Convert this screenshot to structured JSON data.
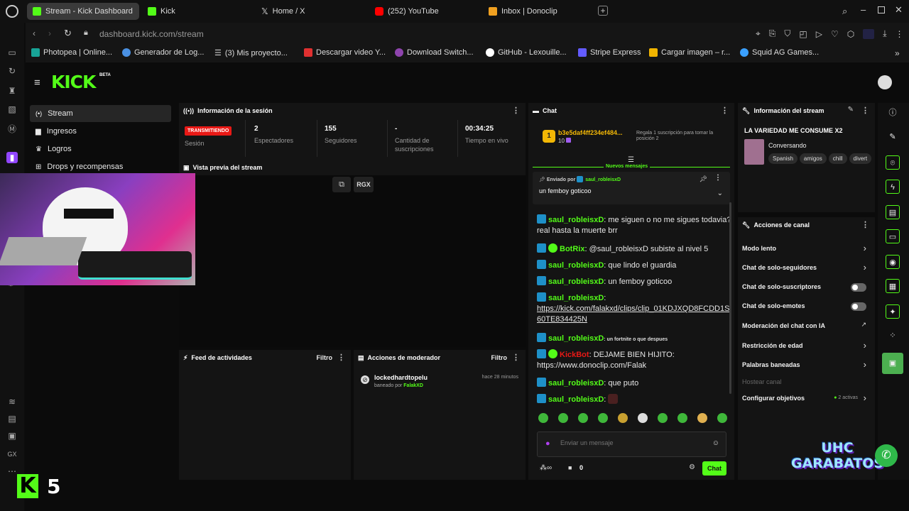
{
  "browser": {
    "tabs": [
      {
        "label": "Stream - Kick Dashboard",
        "active": true,
        "color": "#53fc18"
      },
      {
        "label": "Kick",
        "active": false,
        "color": "#53fc18"
      },
      {
        "label": "Home / X",
        "active": false,
        "color": "#cccccc"
      },
      {
        "label": "(252) YouTube",
        "active": false,
        "color": "#ff0000"
      },
      {
        "label": "Inbox | Donoclip",
        "active": false,
        "color": "#f0a020"
      }
    ],
    "url_host": "dashboard.kick.com",
    "url_path": "/stream",
    "bookmarks": [
      {
        "label": "Photopea | Online...",
        "color": "#18a497"
      },
      {
        "label": "Generador de Log...",
        "color": "#4a90e2"
      },
      {
        "label": "(3) Mis proyecto...",
        "color": "#cccccc"
      },
      {
        "label": "Descargar video Y...",
        "color": "#e03030"
      },
      {
        "label": "Download Switch...",
        "color": "#8e44ad"
      },
      {
        "label": "GitHub - Lexouille...",
        "color": "#ffffff"
      },
      {
        "label": "Stripe Express",
        "color": "#635bff"
      },
      {
        "label": "Cargar imagen – r...",
        "color": "#f0b400"
      },
      {
        "label": "Squid AG Games...",
        "color": "#3aa0ff"
      }
    ]
  },
  "app": {
    "logo": "KICK",
    "logo_badge": "BETA",
    "nav": [
      {
        "label": "Stream",
        "icon": "broadcast-icon",
        "active": true
      },
      {
        "label": "Ingresos",
        "icon": "wallet-icon",
        "active": false
      },
      {
        "label": "Logros",
        "icon": "trophy-icon",
        "active": false
      },
      {
        "label": "Drops y recompensas",
        "icon": "gift-icon",
        "active": false
      }
    ],
    "session": {
      "title": "Información de la sesión",
      "status_badge": "TRANSMITIENDO",
      "status_label": "Sesión",
      "stats": [
        {
          "value": "2",
          "label": "Espectadores"
        },
        {
          "value": "155",
          "label": "Seguidores"
        },
        {
          "value": "-",
          "label": "Cantidad de suscripciones"
        },
        {
          "value": "00:34:25",
          "label": "Tiempo en vivo"
        }
      ]
    },
    "preview": {
      "title": "Vista previa del stream",
      "popout_label": "RGX"
    },
    "activity": {
      "title": "Feed de actividades",
      "filter": "Filtro"
    },
    "modactions": {
      "title": "Acciones de moderador",
      "filter": "Filtro",
      "entries": [
        {
          "user": "lockedhardtopelu",
          "detail_prefix": "baneado por",
          "by": "FalakXD",
          "time": "hace 28 minutos"
        }
      ]
    },
    "chat": {
      "title": "Chat",
      "gifter": {
        "name": "b3e5daf4ff234ef484...",
        "count": "10",
        "promo": "Regala 1 suscripción para tomar la posición 2"
      },
      "new_messages": "Nuevos mensajes",
      "pinned": {
        "sent_by_label": "Enviado por",
        "user": "saul_robleisxD",
        "text": "un femboy goticoo"
      },
      "messages": [
        {
          "user": "saul_robleisxD",
          "text": "me siguen o no me sigues todavia? real hasta la muerte brr"
        },
        {
          "user": "BotRix",
          "text": "@saul_robleisxD subiste al nivel 5"
        },
        {
          "user": "saul_robleisxD",
          "text": "que lindo el guardia"
        },
        {
          "user": "saul_robleisxD",
          "text": "un femboy goticoo"
        },
        {
          "user": "saul_robleisxD",
          "text": "https://kick.com/falakxd/clips/clip_01KDJXQD8FCDD1S60TE834425N"
        },
        {
          "user": "saul_robleisxD",
          "text": ": un fortnite o que despues"
        },
        {
          "user": "KickBot",
          "text": "DEJAME BIEN HIJITO: https://www.donoclip.com/Falak"
        },
        {
          "user": "saul_robleisxD",
          "text": "que puto"
        },
        {
          "user": "saul_robleisxD",
          "text": ""
        }
      ],
      "input_placeholder": "Enviar un mensaje",
      "points": "0",
      "send_label": "Chat"
    },
    "stream_info": {
      "title": "Información del stream",
      "stream_title": "LA VARIEDAD ME CONSUME X2",
      "category": "Conversando",
      "tags": [
        "Spanish",
        "amigos",
        "chill",
        "divert"
      ]
    },
    "channel_actions": {
      "title": "Acciones de canal",
      "items": [
        {
          "label": "Modo lento",
          "kind": "chevron"
        },
        {
          "label": "Chat de solo-seguidores",
          "kind": "chevron"
        },
        {
          "label": "Chat de solo-suscriptores",
          "kind": "toggle"
        },
        {
          "label": "Chat de solo-emotes",
          "kind": "toggle"
        },
        {
          "label": "Moderación del chat con IA",
          "kind": "external"
        },
        {
          "label": "Restricción de edad",
          "kind": "chevron"
        },
        {
          "label": "Palabras baneadas",
          "kind": "chevron"
        },
        {
          "label": "Hostear canal",
          "kind": "disabled"
        },
        {
          "label": "Configurar objetivos",
          "kind": "goal",
          "extra": "2 activas"
        }
      ]
    }
  },
  "overlay": {
    "score": "5",
    "brand": "UHC GARABATOS",
    "rail_label": "GX"
  }
}
